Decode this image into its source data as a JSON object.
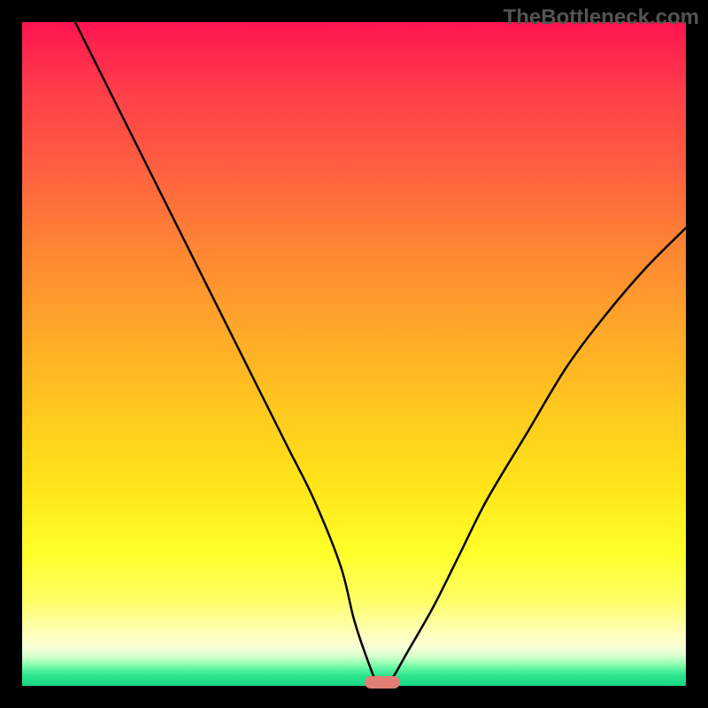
{
  "watermark": "TheBottleneck.com",
  "colors": {
    "page_bg": "#000000",
    "watermark_text": "#545454",
    "curve": "#000000",
    "marker": "#e17f74",
    "gradient_stops": [
      {
        "pct": 0,
        "hex": "#ff1450"
      },
      {
        "pct": 10,
        "hex": "#ff3d4a"
      },
      {
        "pct": 22,
        "hex": "#ff5f40"
      },
      {
        "pct": 34,
        "hex": "#ff8533"
      },
      {
        "pct": 46,
        "hex": "#ffa729"
      },
      {
        "pct": 58,
        "hex": "#ffc71f"
      },
      {
        "pct": 70,
        "hex": "#ffe51a"
      },
      {
        "pct": 80,
        "hex": "#ffff2a"
      },
      {
        "pct": 87,
        "hex": "#ffff66"
      },
      {
        "pct": 92,
        "hex": "#ffffb8"
      },
      {
        "pct": 94,
        "hex": "#f9ffd6"
      },
      {
        "pct": 95.5,
        "hex": "#d8ffcf"
      },
      {
        "pct": 96.5,
        "hex": "#9cffb5"
      },
      {
        "pct": 97.5,
        "hex": "#5cf3a0"
      },
      {
        "pct": 98.5,
        "hex": "#2be38f"
      },
      {
        "pct": 100,
        "hex": "#18d880"
      }
    ]
  },
  "chart_data": {
    "type": "line",
    "title": "",
    "xlabel": "",
    "ylabel": "",
    "xlim": [
      0,
      100
    ],
    "ylim": [
      0,
      100
    ],
    "grid": false,
    "legend": false,
    "series": [
      {
        "name": "bottleneck-curve",
        "x": [
          8,
          12,
          16,
          20,
          24,
          28,
          32,
          36,
          40,
          44,
          48,
          50,
          52,
          53.5,
          55,
          56,
          58,
          62,
          66,
          70,
          76,
          82,
          88,
          94,
          100
        ],
        "y": [
          100,
          92,
          84,
          76,
          68,
          60,
          52,
          44,
          36,
          28,
          18,
          10,
          4,
          0.5,
          0.5,
          1.5,
          5,
          12,
          20,
          28,
          38,
          48,
          56,
          63,
          69
        ]
      }
    ],
    "marker": {
      "x": 54.3,
      "y": 0.5
    }
  }
}
